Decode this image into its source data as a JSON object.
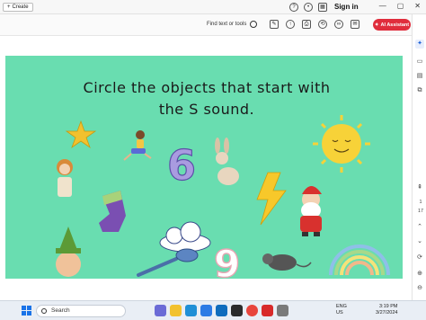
{
  "top_bar": {
    "create_label": "Create",
    "signin_label": "Sign in"
  },
  "toolbar": {
    "find_placeholder": "Find text or tools",
    "ai_assistant_label": "AI Assistant"
  },
  "right_rail": {
    "page_current": "1",
    "page_total": "17"
  },
  "document": {
    "title_line1": "Circle the objects that start with",
    "title_line2": "the S sound."
  },
  "taskbar": {
    "search_label": "Search",
    "lang_line1": "ENG",
    "lang_line2": "US",
    "time": "3:19 PM",
    "date": "3/27/2024"
  },
  "colors": {
    "slide_background": "#69ddb0",
    "ai_button": "#e02d3c",
    "taskbar": "#e9eef5"
  }
}
